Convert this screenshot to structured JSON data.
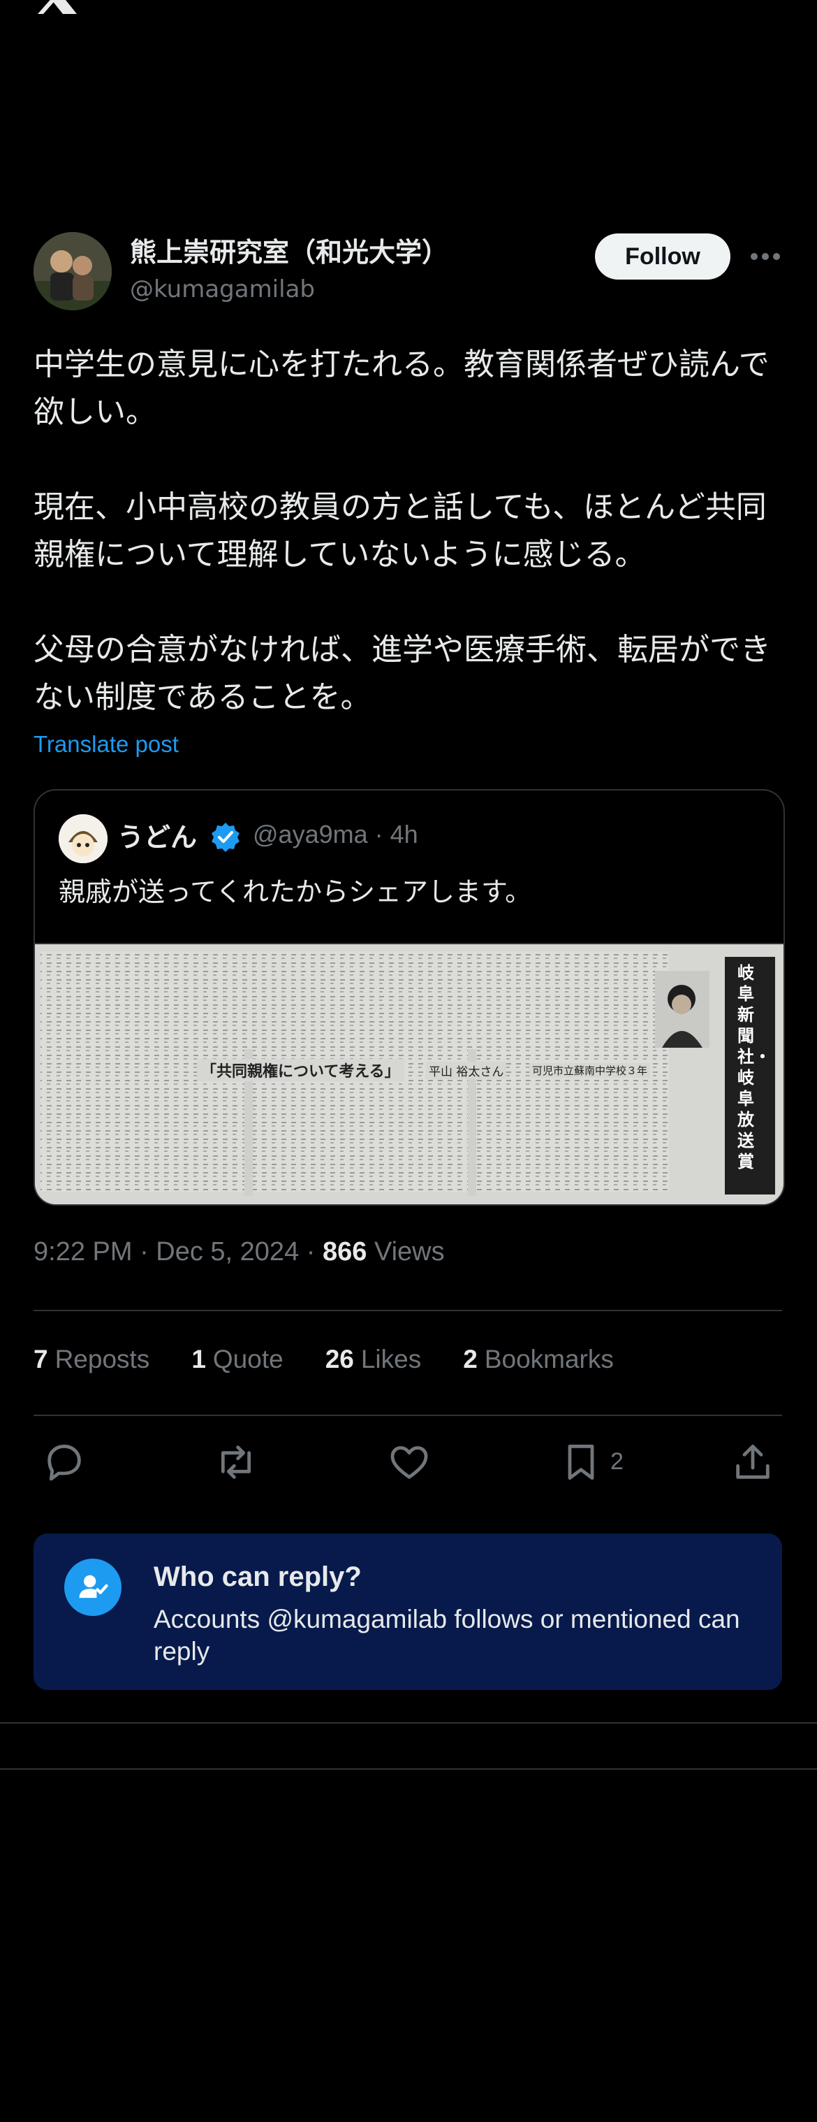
{
  "author": {
    "name": "熊上崇研究室（和光大学）",
    "handle": "@kumagamilab"
  },
  "follow_label": "Follow",
  "post": {
    "paragraphs": [
      "中学生の意見に心を打たれる。教育関係者ぜひ読んで欲しい。",
      "現在、小中高校の教員の方と話しても、ほとんど共同親権について理解していないように感じる。",
      "父母の合意がなければ、進学や医療手術、転居ができない制度であることを。"
    ],
    "translate_label": "Translate post"
  },
  "quote": {
    "name": "うどん",
    "handle_time": "@aya9ma · 4h",
    "text": "親戚が送ってくれたからシェアします。",
    "image": {
      "headline": "「共同親権について考える」",
      "author": "平山 裕太さん",
      "school": "可児市立蘇南中学校３年",
      "sidebar": "岐阜新聞社・岐阜放送賞"
    }
  },
  "meta": {
    "time": "9:22 PM · Dec 5, 2024 · ",
    "views_count": "866",
    "views_label": " Views"
  },
  "stats": {
    "reposts_count": "7",
    "reposts_label": "Reposts",
    "quote_count": "1",
    "quote_label": "Quote",
    "likes_count": "26",
    "likes_label": "Likes",
    "bookmarks_count": "2",
    "bookmarks_label": "Bookmarks"
  },
  "actions": {
    "bookmark_count": "2"
  },
  "who_can_reply": {
    "title": "Who can reply?",
    "description": "Accounts @kumagamilab follows or mentioned can reply"
  },
  "colors": {
    "accent": "#1d9bf0",
    "muted": "#71767b",
    "panel": "#071a4b"
  }
}
